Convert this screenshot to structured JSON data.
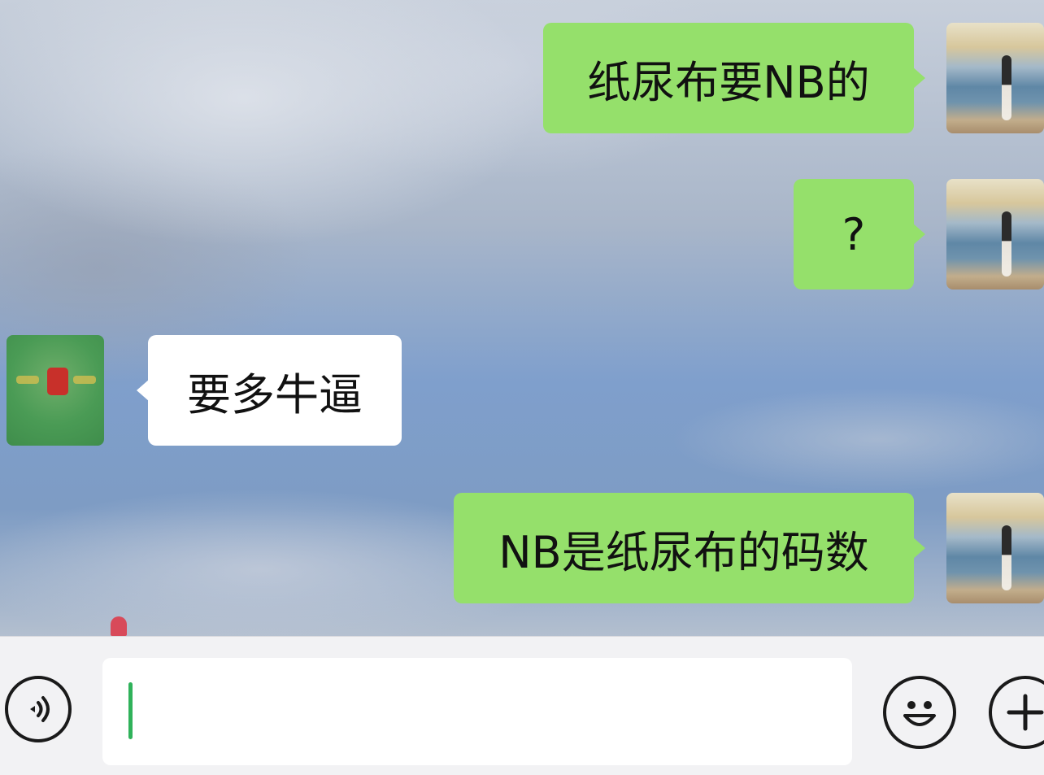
{
  "messages": [
    {
      "side": "right",
      "text": "纸尿布要NB的"
    },
    {
      "side": "right",
      "text": "?"
    },
    {
      "side": "left",
      "text": "要多牛逼"
    },
    {
      "side": "right",
      "text": "NB是纸尿布的码数"
    }
  ],
  "input": {
    "value": "",
    "voice_icon": "voice-icon",
    "emoji_icon": "emoji-icon",
    "plus_icon": "plus-icon"
  },
  "colors": {
    "my_bubble": "#95e06b",
    "other_bubble": "#ffffff",
    "caret": "#2fb25a",
    "other_avatar": "#4a9b55"
  }
}
